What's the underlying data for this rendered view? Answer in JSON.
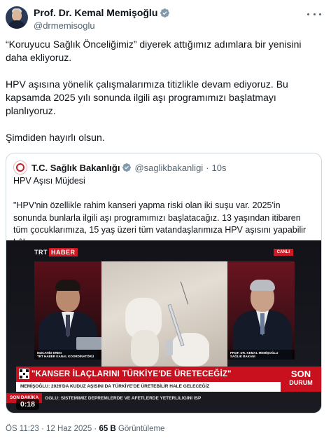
{
  "author": {
    "name": "Prof. Dr. Kemal Memişoğlu",
    "handle": "@drmemisoglu"
  },
  "tweet": {
    "paragraphs": [
      "“Koruyucu Sağlık Önceliğimiz” diyerek attığımız adımlara bir yenisini daha ekliyoruz.",
      "HPV aşısına yönelik çalışmalarımıza titizlikle devam ediyoruz. Bu kapsamda 2025 yılı sonunda ilgili aşı programımızı başlatmayı planlıyoruz.",
      "Şimdiden hayırlı olsun."
    ]
  },
  "quote": {
    "name": "T.C. Sağlık Bakanlığı",
    "handle": "@saglikbakanligi",
    "separator": "·",
    "time": "10s",
    "subtitle": "HPV Aşısı Müjdesi",
    "body": "\"HPV'nin özellikle rahim kanseri yapma riski olan iki suşu var. 2025'in sonunda bunlarla ilgili aşı programımızı başlatacağız. 13 yaşından itibaren tüm çocuklarımıza, 15 yaş üzeri tüm vatandaşlarımıza HPV aşısını yapabilir hâle ..."
  },
  "video": {
    "channel_trt": "TRT",
    "channel_haber": "HABER",
    "live_label": "CANLI",
    "left_caption_line1": "MUCAHİD EREN",
    "left_caption_line2": "TRT HABER KANAL KOORDİNATÖRÜ",
    "right_caption_line1": "PROF. DR. KEMAL MEMİŞOĞLU",
    "right_caption_line2": "SAĞLIK BAKANI",
    "headline": "\"KANSER İLAÇLARINI TÜRKİYE'DE ÜRETECEĞİZ\"",
    "subline": "MEMİŞOĞLU: 2026'DA KUDUZ AŞISINI DA TÜRKİYE'DE ÜRETEBİLİR HALE GELECEĞİZ",
    "son_line1": "SON",
    "son_line2": "DURUM",
    "ticker_label": "SON DAKİKA",
    "ticker_text": "OĞLU: SİSTEMİMİZ DEPREMLERDE VE AFETLERDE YETERLİLİĞİNİ İSP",
    "duration": "0:18"
  },
  "meta": {
    "time": "ÖS 11:23",
    "date": "12 Haz 2025",
    "views_count": "65 B",
    "views_label": "Görüntüleme",
    "separator": "·"
  },
  "colors": {
    "verified_blue": "#1d9bf0",
    "verified_gov_gray": "#829aab",
    "trt_red": "#c9101f"
  },
  "icons": [
    "verified-badge-icon",
    "government-badge-icon",
    "more-options-icon",
    "ministry-logo-icon",
    "qr-code-icon"
  ]
}
